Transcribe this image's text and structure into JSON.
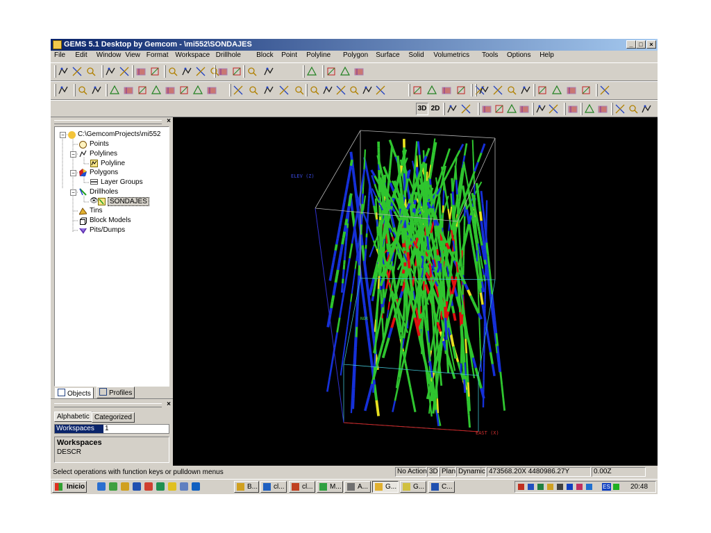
{
  "window": {
    "title": "GEMS 5.1 Desktop by Gemcom - \\mi552\\SONDAJES"
  },
  "menu": [
    "File",
    "Edit",
    "Window",
    "View",
    "Format",
    "Workspace",
    "Drillhole",
    "Block",
    "Point",
    "Polyline",
    "Polygon",
    "Surface",
    "Solid",
    "Volumetrics",
    "Tools",
    "Options",
    "Help"
  ],
  "toolbar": {
    "view_3d": "3D",
    "view_2d": "2D"
  },
  "tree": {
    "root": "C:\\GemcomProjects\\mi552",
    "points": "Points",
    "polylines": "Polylines",
    "polyline": "Polyline",
    "polygons": "Polygons",
    "layer_groups": "Layer Groups",
    "drillholes": "Drillholes",
    "sondajes": "SONDAJES",
    "tins": "Tins",
    "block_models": "Block Models",
    "pits_dumps": "Pits/Dumps"
  },
  "tabs": {
    "objects": "Objects",
    "profiles": "Profiles",
    "alphabetic": "Alphabetic",
    "categorized": "Categorized"
  },
  "properties": {
    "row_name": "Workspaces",
    "row_value": "1",
    "desc_title": "Workspaces",
    "desc_text": "DESCR"
  },
  "viewport": {
    "axis_z": "ELEV (Z)",
    "axis_x": "EAST (X)",
    "axis_n": "NOR"
  },
  "colors": {
    "green": "#2fc52f",
    "blue": "#1530d8",
    "red": "#e01010",
    "yellow": "#e8e020",
    "box": "#b8b8b8",
    "box_cyan": "#40c0d0",
    "axis_red": "#d02020",
    "axis_blue": "#3030d0"
  },
  "status": {
    "hint": "Select operations with function keys or pulldown menus",
    "action": "No Action",
    "mode_3d": "3D",
    "plan": "Plan",
    "dynamic": "Dynamic",
    "coords": "473568.20X  4480986.27Y",
    "z": "0.00Z"
  },
  "taskbar": {
    "start": "Inicio",
    "clock": "20:48",
    "lang": "ES",
    "items": [
      "B...",
      "cl...",
      "cl...",
      "M...",
      "A...",
      "G...",
      "G...",
      "C..."
    ]
  }
}
